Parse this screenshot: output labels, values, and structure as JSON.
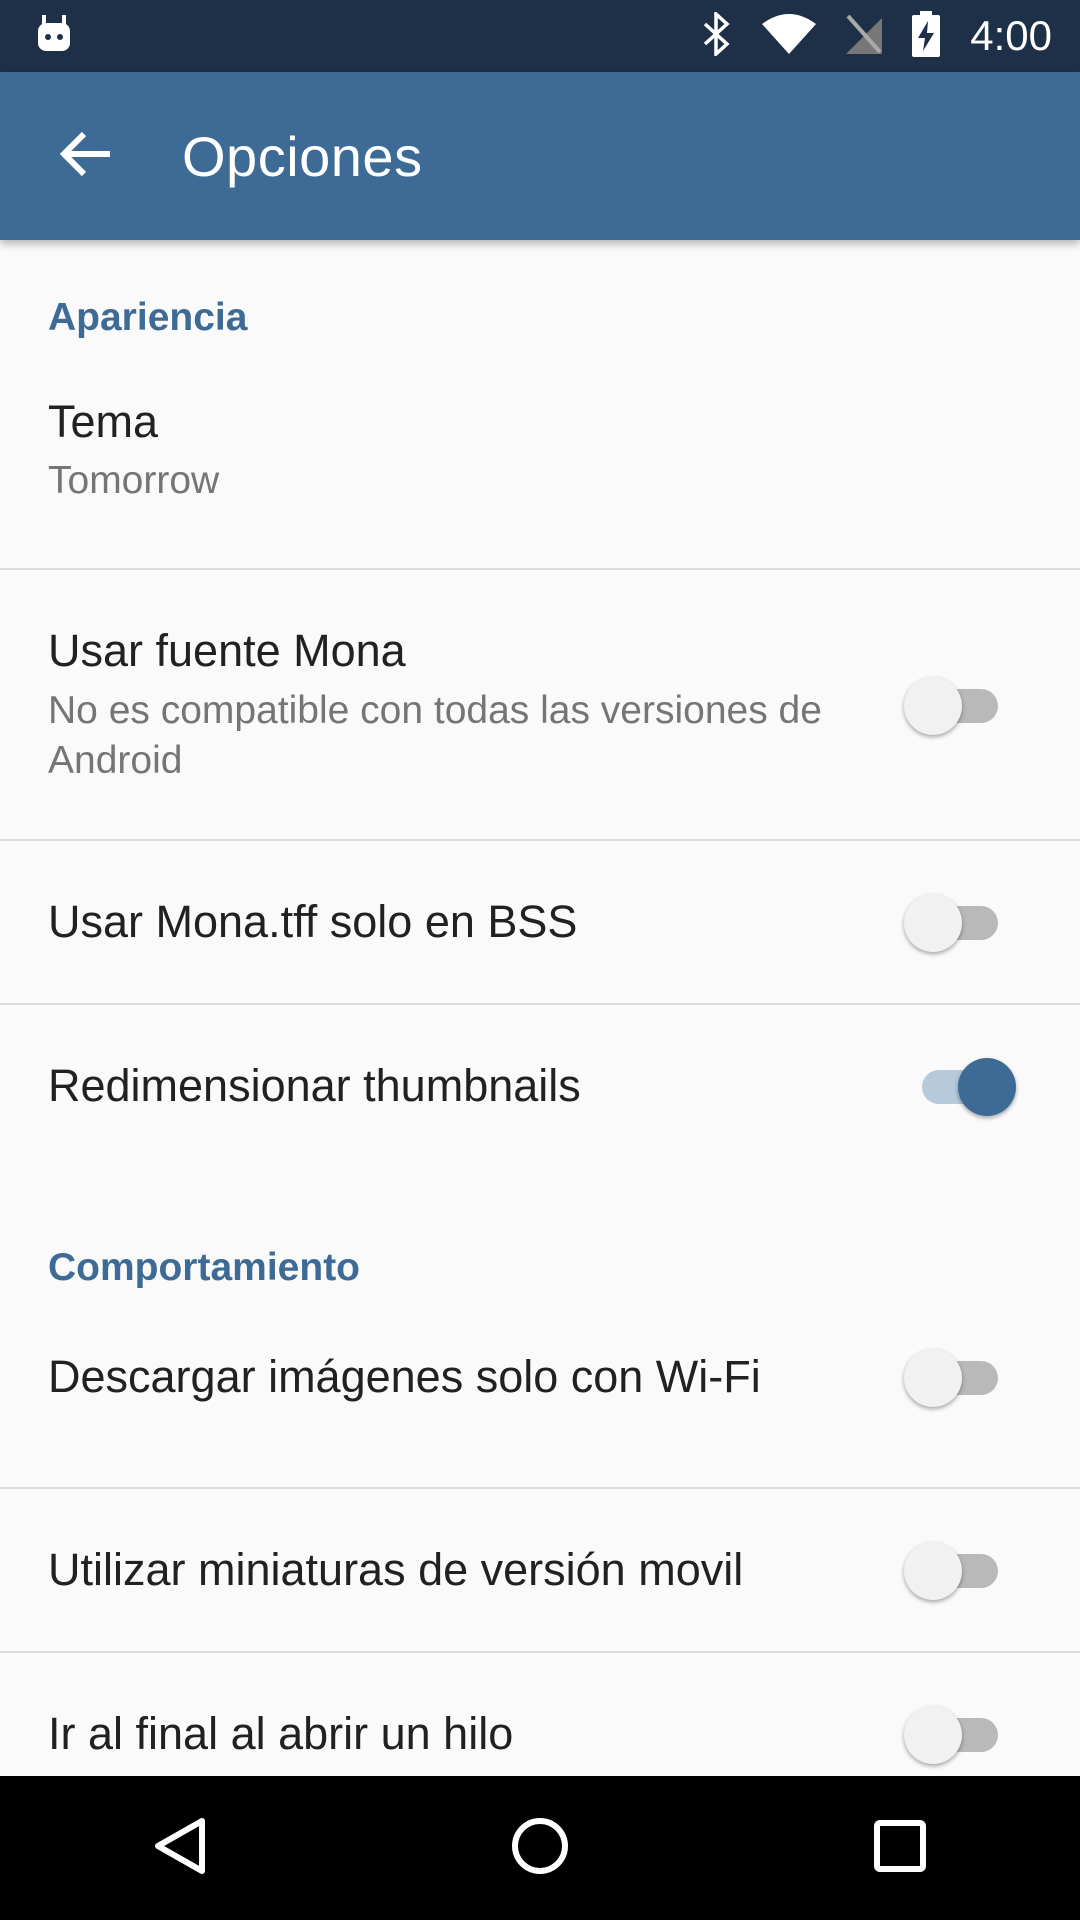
{
  "status_bar": {
    "time": "4:00",
    "icons": [
      "android-icon",
      "bluetooth-icon",
      "wifi-icon",
      "no-sim-icon",
      "battery-charging-icon"
    ]
  },
  "app_bar": {
    "title": "Opciones",
    "back_icon": "arrow-back-icon",
    "color": "#3d6b96"
  },
  "sections": {
    "appearance": {
      "header": "Apariencia",
      "theme": {
        "title": "Tema",
        "summary": "Tomorrow"
      },
      "mona_font": {
        "title": "Usar fuente Mona",
        "summary": "No es compatible con todas las versiones de Android",
        "enabled": false
      },
      "mona_bss": {
        "title": "Usar Mona.tff solo en BSS",
        "enabled": false
      },
      "resize_thumbs": {
        "title": "Redimensionar thumbnails",
        "enabled": true
      }
    },
    "behavior": {
      "header": "Comportamiento",
      "wifi_images": {
        "title": "Descargar imágenes solo con Wi-Fi",
        "enabled": false
      },
      "mobile_thumbs": {
        "title": "Utilizar miniaturas de versión movil",
        "enabled": false
      },
      "go_to_end": {
        "title": "Ir al final al abrir un hilo",
        "enabled": false
      }
    }
  },
  "nav_bar": {
    "buttons": [
      "back-triangle-icon",
      "home-circle-icon",
      "recents-square-icon"
    ]
  }
}
